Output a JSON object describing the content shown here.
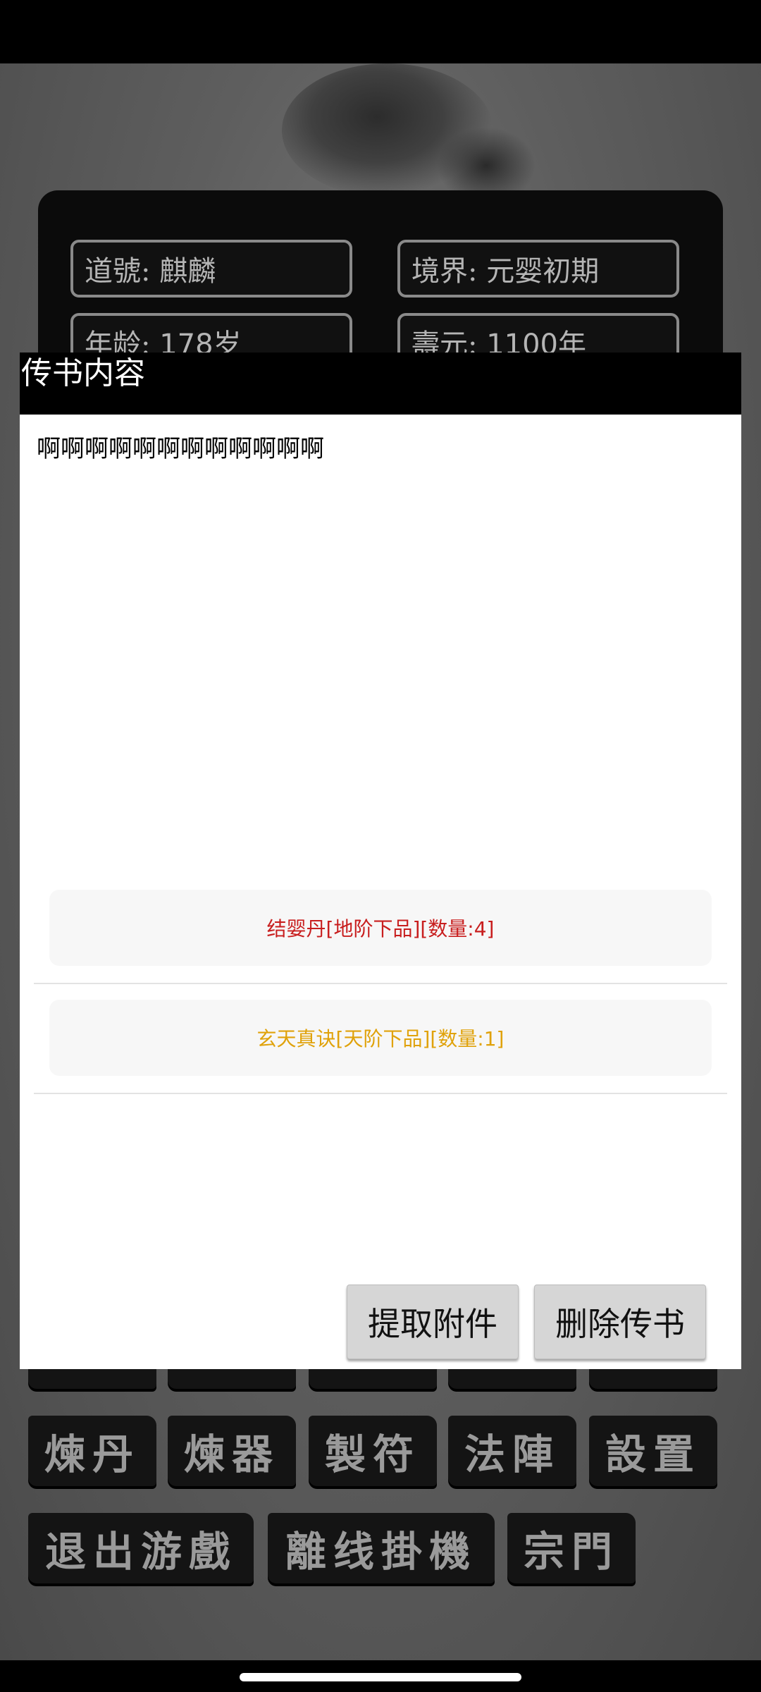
{
  "profile": {
    "dao_name_label": "道號:",
    "dao_name_value": "麒麟",
    "realm_label": "境界:",
    "realm_value": "元婴初期",
    "age_label": "年龄:",
    "age_value": "178岁",
    "lifespan_label": "壽元:",
    "lifespan_value": "1100年"
  },
  "menu": {
    "row2": [
      "煉丹",
      "煉器",
      "製符",
      "法陣",
      "設置"
    ],
    "row3": [
      "退出游戲",
      "離线掛機",
      "宗門"
    ]
  },
  "dialog": {
    "title": "传书内容",
    "message": "啊啊啊啊啊啊啊啊啊啊啊啊",
    "attachments": [
      {
        "text": "结婴丹[地阶下品][数量:4]",
        "color": "#c81e1e"
      },
      {
        "text": "玄天真诀[天阶下品][数量:1]",
        "color": "#e0a20a"
      }
    ],
    "extract_button": "提取附件",
    "delete_button": "删除传书"
  }
}
